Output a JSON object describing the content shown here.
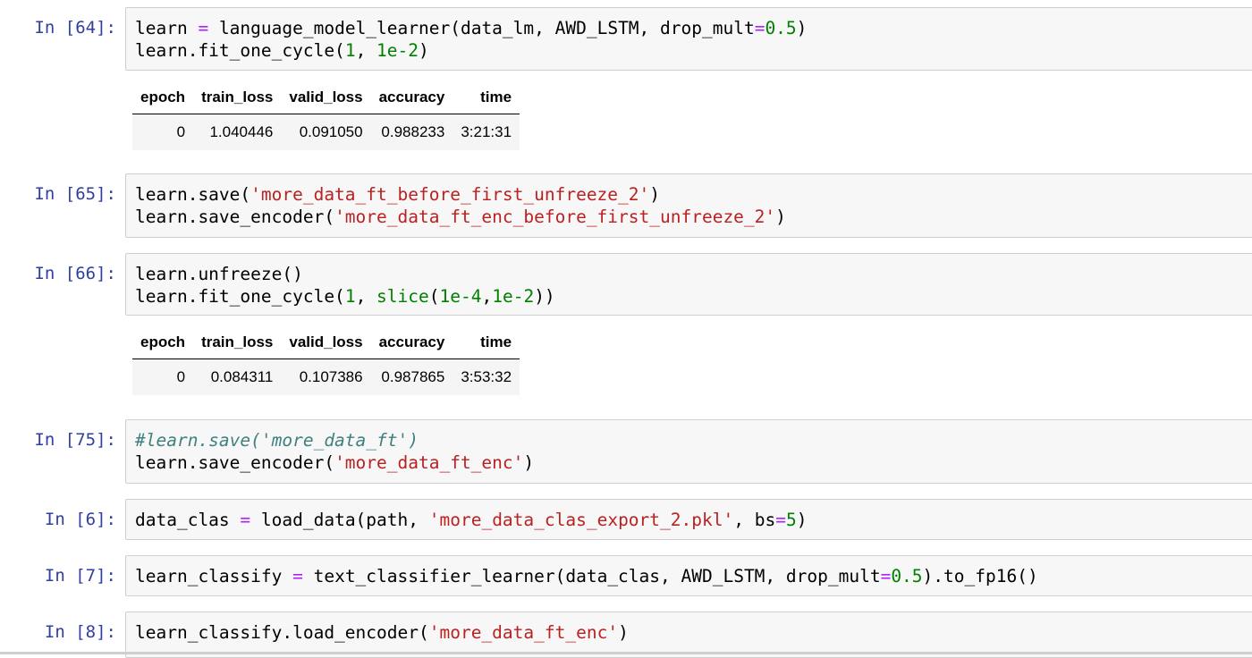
{
  "cells": [
    {
      "prompt": "In [64]:",
      "lines": [
        [
          [
            "learn ",
            ""
          ],
          [
            "=",
            "op"
          ],
          [
            " language_model_learner(data_lm, AWD_LSTM, drop_mult",
            ""
          ],
          [
            "=",
            "op"
          ],
          [
            "0.5",
            "num"
          ],
          [
            ")",
            ""
          ]
        ],
        [
          [
            "learn.fit_one_cycle(",
            ""
          ],
          [
            "1",
            "num"
          ],
          [
            ", ",
            ""
          ],
          [
            "1e-2",
            "num"
          ],
          [
            ")",
            ""
          ]
        ]
      ],
      "output_table": {
        "columns": [
          "epoch",
          "train_loss",
          "valid_loss",
          "accuracy",
          "time"
        ],
        "rows": [
          [
            "0",
            "1.040446",
            "0.091050",
            "0.988233",
            "3:21:31"
          ]
        ]
      }
    },
    {
      "prompt": "In [65]:",
      "lines": [
        [
          [
            "learn.save(",
            ""
          ],
          [
            "'more_data_ft_before_first_unfreeze_2'",
            "str"
          ],
          [
            ")",
            ""
          ]
        ],
        [
          [
            "learn.save_encoder(",
            ""
          ],
          [
            "'more_data_ft_enc_before_first_unfreeze_2'",
            "str"
          ],
          [
            ")",
            ""
          ]
        ]
      ]
    },
    {
      "prompt": "In [66]:",
      "lines": [
        [
          [
            "learn.unfreeze()",
            ""
          ]
        ],
        [
          [
            "learn.fit_one_cycle(",
            ""
          ],
          [
            "1",
            "num"
          ],
          [
            ", ",
            ""
          ],
          [
            "slice",
            "num"
          ],
          [
            "(",
            ""
          ],
          [
            "1e-4",
            "num"
          ],
          [
            ",",
            ""
          ],
          [
            "1e-2",
            "num"
          ],
          [
            "))",
            ""
          ]
        ]
      ],
      "output_table": {
        "columns": [
          "epoch",
          "train_loss",
          "valid_loss",
          "accuracy",
          "time"
        ],
        "rows": [
          [
            "0",
            "0.084311",
            "0.107386",
            "0.987865",
            "3:53:32"
          ]
        ]
      }
    },
    {
      "prompt": "In [75]:",
      "lines": [
        [
          [
            "#learn.save('more_data_ft')",
            "cm"
          ]
        ],
        [
          [
            "learn.save_encoder(",
            ""
          ],
          [
            "'more_data_ft_enc'",
            "str"
          ],
          [
            ")",
            ""
          ]
        ]
      ]
    },
    {
      "prompt": "In [6]:",
      "lines": [
        [
          [
            "data_clas ",
            ""
          ],
          [
            "=",
            "op"
          ],
          [
            " load_data(path, ",
            ""
          ],
          [
            "'more_data_clas_export_2.pkl'",
            "str"
          ],
          [
            ", bs",
            ""
          ],
          [
            "=",
            "op"
          ],
          [
            "5",
            "num"
          ],
          [
            ")",
            ""
          ]
        ]
      ]
    },
    {
      "prompt": "In [7]:",
      "lines": [
        [
          [
            "learn_classify ",
            ""
          ],
          [
            "=",
            "op"
          ],
          [
            " text_classifier_learner(data_clas, AWD_LSTM, drop_mult",
            ""
          ],
          [
            "=",
            "op"
          ],
          [
            "0.5",
            "num"
          ],
          [
            ").to_fp16()",
            ""
          ]
        ]
      ]
    },
    {
      "prompt": "In [8]:",
      "lines": [
        [
          [
            "learn_classify.load_encoder(",
            ""
          ],
          [
            "'more_data_ft_enc'",
            "str"
          ],
          [
            ")",
            ""
          ]
        ]
      ]
    }
  ]
}
